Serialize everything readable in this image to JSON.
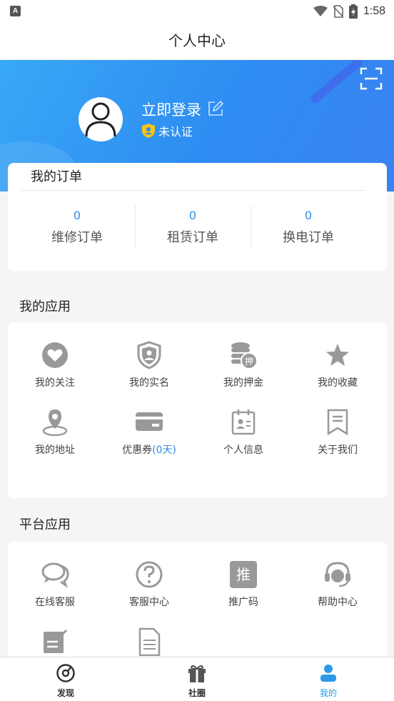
{
  "status_bar": {
    "time": "1:58",
    "app_badge": "A",
    "icons": [
      "wifi-icon",
      "no-sim-icon",
      "battery-charging-icon"
    ]
  },
  "header": {
    "title": "个人中心"
  },
  "profile": {
    "login_label": "立即登录",
    "verify_status": "未认证",
    "icons": [
      "avatar-icon",
      "edit-icon",
      "shield-icon",
      "scan-icon"
    ]
  },
  "orders": {
    "title": "我的订单",
    "items": [
      {
        "count": "0",
        "label": "维修订单"
      },
      {
        "count": "0",
        "label": "租赁订单"
      },
      {
        "count": "0",
        "label": "换电订单"
      }
    ]
  },
  "my_apps": {
    "title": "我的应用",
    "items": [
      {
        "label": "我的关注",
        "icon": "heart-icon"
      },
      {
        "label": "我的实名",
        "icon": "id-shield-icon"
      },
      {
        "label": "我的押金",
        "icon": "deposit-icon"
      },
      {
        "label": "我的收藏",
        "icon": "star-icon"
      },
      {
        "label": "我的地址",
        "icon": "location-icon"
      },
      {
        "label": "优惠券",
        "suffix": "(0天)",
        "icon": "card-icon"
      },
      {
        "label": "个人信息",
        "icon": "profile-card-icon"
      },
      {
        "label": "关于我们",
        "icon": "bookmark-icon"
      }
    ]
  },
  "platform_apps": {
    "title": "平台应用",
    "items": [
      {
        "label": "在线客服",
        "icon": "chat-icon"
      },
      {
        "label": "客服中心",
        "icon": "question-icon"
      },
      {
        "label": "推广码",
        "icon": "promo-icon",
        "badge": "推"
      },
      {
        "label": "帮助中心",
        "icon": "headset-icon"
      },
      {
        "label": "",
        "icon": "note-edit-icon"
      },
      {
        "label": "",
        "icon": "document-icon"
      }
    ]
  },
  "tabs": [
    {
      "label": "发现",
      "icon": "discover-icon"
    },
    {
      "label": "社圈",
      "icon": "gift-icon"
    },
    {
      "label": "我的",
      "icon": "user-icon",
      "active": true
    }
  ],
  "colors": {
    "accent": "#2a8be8",
    "hero_gradient_start": "#38a8f5",
    "hero_gradient_end": "#3b82f0",
    "icon_gray": "#999999",
    "shield_yellow": "#f5c518"
  }
}
